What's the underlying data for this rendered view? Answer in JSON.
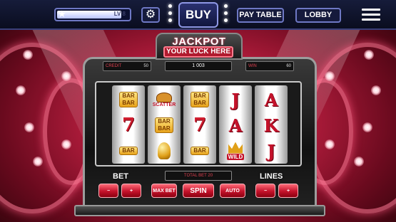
{
  "topbar": {
    "level_text": "LV 8",
    "level_progress": 0.9,
    "settings_icon": "gear-icon",
    "buy_label": "BUY",
    "pay_table_label": "PAY TABLE",
    "lobby_label": "LOBBY",
    "menu_icon": "hamburger-icon"
  },
  "machine": {
    "title": "JACKPOT",
    "subtitle": "YOUR LUCK HERE",
    "credit_label": "CREDIT",
    "credit_value": "50",
    "win_display": "1 003",
    "win_label": "WIN",
    "win_value": "60",
    "total_bet_label": "TOTAL BET 20",
    "bet_label": "BET",
    "lines_label": "LINES",
    "buttons": {
      "bet_minus": "−",
      "bet_plus": "+",
      "max_bet": "MAX BET",
      "spin": "SPIN",
      "auto": "AUTO",
      "lines_minus": "−",
      "lines_plus": "+"
    }
  },
  "reels": [
    {
      "symbols": [
        "BAR BAR",
        "7",
        "BAR"
      ]
    },
    {
      "symbols": [
        "SCATTER",
        "BAR BAR",
        "BELL"
      ]
    },
    {
      "symbols": [
        "BAR BAR",
        "7",
        "BAR"
      ]
    },
    {
      "symbols": [
        "J",
        "A",
        "WILD"
      ]
    },
    {
      "symbols": [
        "A",
        "K",
        "J"
      ]
    }
  ],
  "colors": {
    "accent_red": "#c4122a",
    "topbar_bg": "#0a0d1f",
    "topbar_border": "#6e78c4"
  }
}
